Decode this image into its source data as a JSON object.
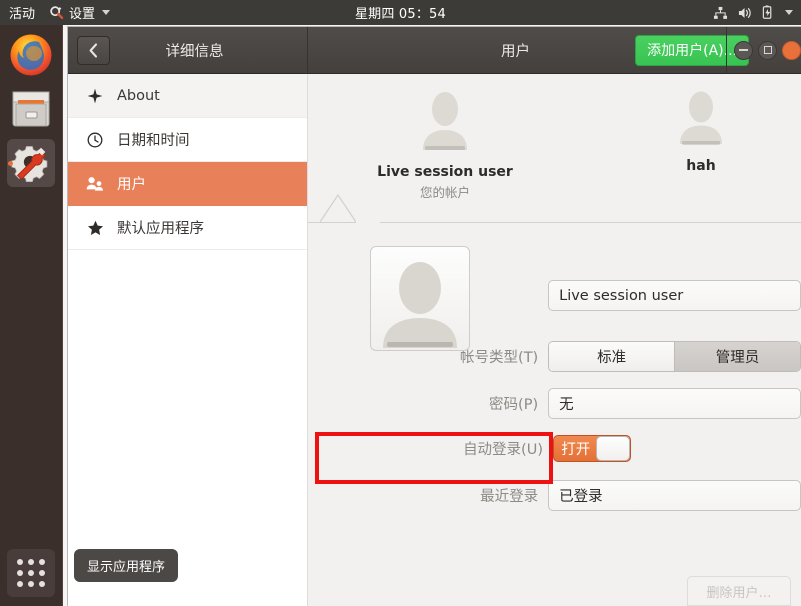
{
  "topbar": {
    "activities": "活动",
    "app_menu_label": "设置",
    "app_menu_icon": "settings-wrench-gear-icon",
    "clock": "星期四 05：54",
    "status_icons": [
      "network-icon",
      "volume-icon",
      "battery-charging-icon",
      "chevron-down-icon"
    ]
  },
  "dock": {
    "items": [
      {
        "name": "firefox",
        "icon": "firefox-icon",
        "active": false
      },
      {
        "name": "files",
        "icon": "file-manager-icon",
        "active": false
      },
      {
        "name": "settings",
        "icon": "settings-wrench-gear-icon",
        "active": true
      }
    ],
    "show_apps_label": "显示应用程序",
    "show_apps_icon": "app-grid-icon"
  },
  "window": {
    "back_icon": "chevron-left-icon",
    "title_left": "详细信息",
    "title_right": "用户",
    "add_user_label": "添加用户(A)...",
    "controls": {
      "minimize": "minimize-icon",
      "maximize": "maximize-icon",
      "close": "close-icon"
    }
  },
  "sidebar": {
    "items": [
      {
        "label": "About",
        "icon": "sparkle-icon",
        "selected": false
      },
      {
        "label": "日期和时间",
        "icon": "clock-icon",
        "selected": false
      },
      {
        "label": "用户",
        "icon": "users-icon",
        "selected": true
      },
      {
        "label": "默认应用程序",
        "icon": "star-icon",
        "selected": false
      }
    ],
    "selected_color": "#e8805a"
  },
  "users": [
    {
      "name": "Live session user",
      "subtitle": "您的帐户",
      "selected": true
    },
    {
      "name": "hah",
      "subtitle": "",
      "selected": false
    }
  ],
  "details": {
    "avatar_icon": "user-avatar-icon",
    "name_value": "Live session user",
    "rows": [
      {
        "label": "帐号类型(T)",
        "type": "segmented"
      },
      {
        "label": "密码(P)",
        "type": "field",
        "value": "无"
      },
      {
        "label": "自动登录(U)",
        "type": "toggle"
      },
      {
        "label": "最近登录",
        "type": "field",
        "value": "已登录"
      }
    ],
    "account_type": {
      "option_standard": "标准",
      "option_admin": "管理员",
      "selected": "管理员"
    },
    "password_value": "无",
    "autologin": {
      "state_label": "打开",
      "on": true,
      "highlight_color": "#ee1111"
    },
    "last_login_value": "已登录",
    "remove_user_label": "删除用户…"
  }
}
